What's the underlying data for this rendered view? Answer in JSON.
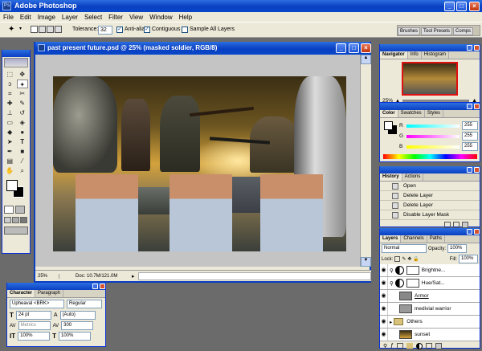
{
  "app": {
    "title": "Adobe Photoshop",
    "menus": [
      "File",
      "Edit",
      "Image",
      "Layer",
      "Select",
      "Filter",
      "View",
      "Window",
      "Help"
    ]
  },
  "options": {
    "tolerance_label": "Tolerance:",
    "tolerance_value": "32",
    "anti_alias_label": "Anti-alias",
    "contiguous_label": "Contiguous",
    "sample_all_label": "Sample All Layers",
    "well_tabs": [
      "Brushes",
      "Tool Presets",
      "Comps"
    ]
  },
  "document": {
    "title": "past present future.psd @ 25% (masked soldier, RGB/8)",
    "zoom": "25%",
    "doc_info": "Doc: 10.7M/121.0M"
  },
  "navigator": {
    "tabs": [
      "Navigator",
      "Info",
      "Histogram"
    ],
    "zoom": "25%"
  },
  "color": {
    "tabs": [
      "Color",
      "Swatches",
      "Styles"
    ],
    "channels": [
      {
        "label": "R",
        "value": "255"
      },
      {
        "label": "G",
        "value": "255"
      },
      {
        "label": "B",
        "value": "255"
      }
    ]
  },
  "history": {
    "tabs": [
      "History",
      "Actions"
    ],
    "items": [
      "Open",
      "Delete Layer",
      "Delete Layer",
      "Disable Layer Mask"
    ]
  },
  "layers": {
    "tabs": [
      "Layers",
      "Channels",
      "Paths"
    ],
    "blend_mode": "Normal",
    "opacity_label": "Opacity:",
    "opacity": "100%",
    "lock_label": "Lock:",
    "fill_label": "Fill:",
    "fill": "100%",
    "items": [
      {
        "name": "Brightne..."
      },
      {
        "name": "Hue/Sat..."
      },
      {
        "name": "Armor"
      },
      {
        "name": "medivial warrior"
      },
      {
        "name": "Others"
      },
      {
        "name": "sunset"
      }
    ]
  },
  "character": {
    "tabs": [
      "Character",
      "Paragraph"
    ],
    "font_family": "Upheaval <BRK>",
    "font_style": "Regular",
    "font_size": "24 pt",
    "leading": "(Auto)",
    "kerning": "Metrics",
    "tracking": "300",
    "vscale": "100%",
    "hscale": "100%"
  },
  "colors": {
    "xp_blue": "#0a3fc2",
    "chrome": "#ece9d8",
    "workspace": "#6b6b6b"
  }
}
